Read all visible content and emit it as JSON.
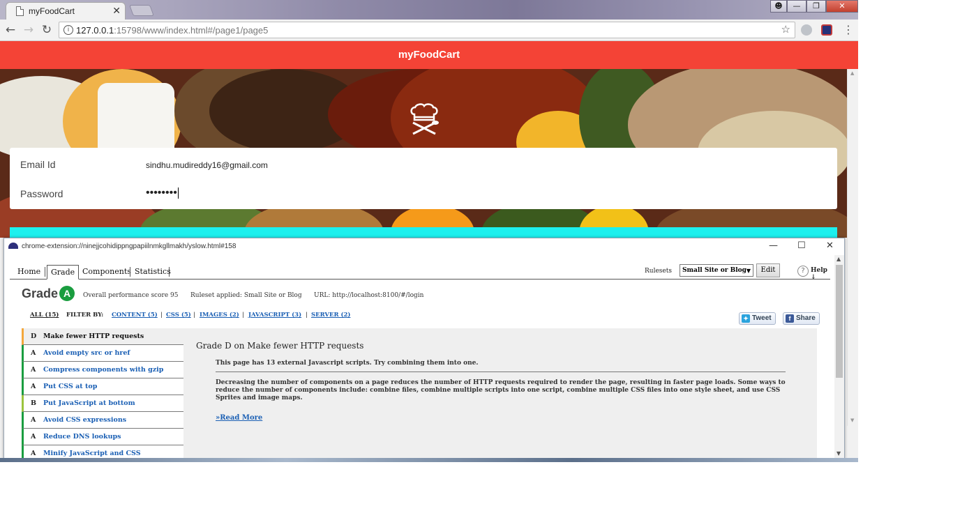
{
  "browser": {
    "tab_title": "myFoodCart",
    "tab_close": "✕",
    "url_host": "127.0.0.1",
    "url_rest": ":15798/www/index.html#/page1/page5",
    "icons": [
      "back-icon",
      "forward-icon",
      "reload-icon",
      "info-icon",
      "star-icon",
      "menu-icon"
    ]
  },
  "app": {
    "title": "myFoodCart",
    "accent": "#f44336",
    "cyan": "#1df0ee"
  },
  "login": {
    "email_label": "Email Id",
    "email_value": "sindhu.mudireddy16@gmail.com",
    "password_label": "Password",
    "password_value": "••••••••"
  },
  "yslow": {
    "window_url": "chrome-extension://ninejjcohidippngpapiilnmkgllmakh/yslow.html#158",
    "tabs": [
      "Home",
      "Grade",
      "Components",
      "Statistics"
    ],
    "active_tab": "Grade",
    "rulesets_label": "Rulesets",
    "ruleset_selected": "Small Site or Blog",
    "edit_label": "Edit",
    "help_label": "Help",
    "grade_word": "Grade",
    "grade_letter": "A",
    "overall_score": "Overall performance score 95",
    "ruleset_applied": "Ruleset applied: Small Site or Blog",
    "url_tested": "URL: http://localhost:8100/#/login",
    "filter": {
      "all": "ALL (15)",
      "filter_by": "FILTER BY:",
      "content": "CONTENT (5)",
      "css": "CSS (5)",
      "images": "IMAGES (2)",
      "javascript": "JAVASCRIPT (3)",
      "server": "SERVER (2)"
    },
    "tweet_label": "Tweet",
    "share_label": "Share",
    "rules": [
      {
        "grade": "D",
        "title": "Make fewer HTTP requests"
      },
      {
        "grade": "A",
        "title": "Avoid empty src or href"
      },
      {
        "grade": "A",
        "title": "Compress components with gzip"
      },
      {
        "grade": "A",
        "title": "Put CSS at top"
      },
      {
        "grade": "B",
        "title": "Put JavaScript at bottom"
      },
      {
        "grade": "A",
        "title": "Avoid CSS expressions"
      },
      {
        "grade": "A",
        "title": "Reduce DNS lookups"
      },
      {
        "grade": "A",
        "title": "Minify JavaScript and CSS"
      }
    ],
    "detail": {
      "title": "Grade D on Make fewer HTTP requests",
      "summary": "This page has 13 external Javascript scripts. Try combining them into one.",
      "description": "Decreasing the number of components on a page reduces the number of HTTP requests required to render the page, resulting in faster page loads. Some ways to reduce the number of components include: combine files, combine multiple scripts into one script, combine multiple CSS files into one style sheet, and use CSS Sprites and image maps.",
      "read_more": "»Read More"
    }
  }
}
